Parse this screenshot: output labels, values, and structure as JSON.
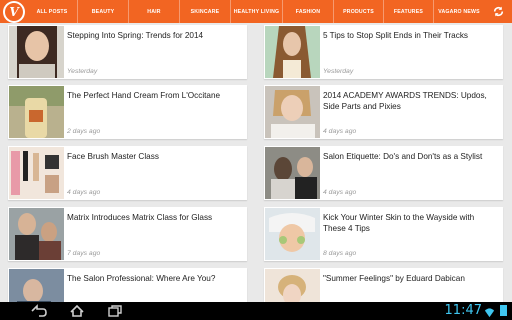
{
  "brand": {
    "logo_letter": "V",
    "accent": "#f26522"
  },
  "tabs": [
    "ALL POSTS",
    "BEAUTY",
    "HAIR",
    "SKINCARE",
    "HEALTHY LIVING",
    "FASHION",
    "PRODUCTS",
    "FEATURES",
    "VAGARO NEWS"
  ],
  "articles_left": [
    {
      "title": "Stepping Into Spring: Trends for 2014",
      "time": "Yesterday"
    },
    {
      "title": "The Perfect Hand Cream From L'Occitane",
      "time": "2 days ago"
    },
    {
      "title": "Face Brush Master Class",
      "time": "4 days ago"
    },
    {
      "title": "Matrix Introduces Matrix Class for Glass",
      "time": "7 days ago"
    },
    {
      "title": "The Salon Professional: Where Are You?",
      "time": ""
    }
  ],
  "articles_right": [
    {
      "title": "5 Tips to Stop Split Ends in Their Tracks",
      "time": "Yesterday"
    },
    {
      "title": "2014 ACADEMY AWARDS TRENDS: Updos, Side Parts and Pixies",
      "time": "4 days ago"
    },
    {
      "title": "Salon Etiquette: Do's and Don'ts as a Stylist",
      "time": "4 days ago"
    },
    {
      "title": "Kick Your Winter Skin to the Wayside with These 4 Tips",
      "time": "8 days ago"
    },
    {
      "title": "\"Summer Feelings\" by Eduard Dabican",
      "time": ""
    }
  ],
  "statusbar": {
    "time": "11:47",
    "accent": "#3fc6f0"
  }
}
